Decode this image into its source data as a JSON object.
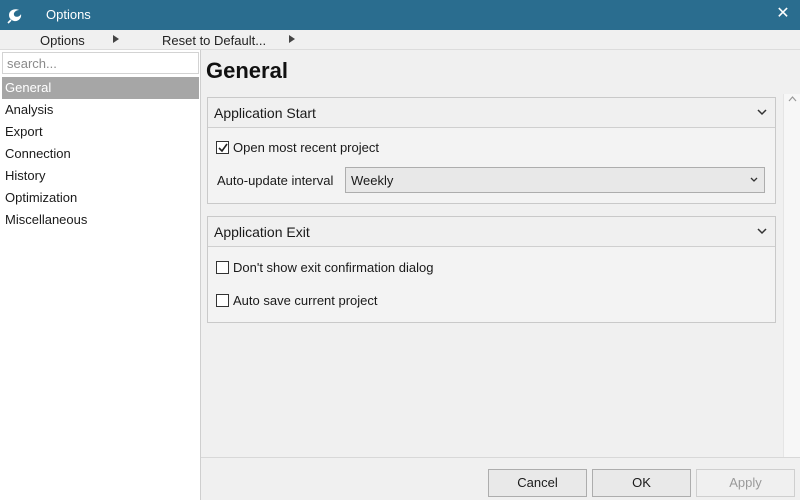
{
  "window": {
    "title": "Options",
    "close_glyph": "✕",
    "title_bar_color": "#2a6d8f",
    "logo_icon": "app-logo-icon"
  },
  "menu": {
    "options_label": "Options",
    "reset_label": "Reset to Default...",
    "arrow_icon": "triangle-right-icon"
  },
  "sidebar": {
    "search_placeholder": "search...",
    "selected_color": "#a6a6a6",
    "items": [
      {
        "label": "General",
        "selected": true
      },
      {
        "label": "Analysis"
      },
      {
        "label": "Export"
      },
      {
        "label": "Connection"
      },
      {
        "label": "History"
      },
      {
        "label": "Optimization"
      },
      {
        "label": "Miscellaneous"
      }
    ]
  },
  "main": {
    "title": "General",
    "sections": [
      {
        "title": "Application Start",
        "checkbox_open_recent": {
          "label": "Open most recent project",
          "checked": true
        },
        "auto_update": {
          "label": "Auto-update interval",
          "value": "Weekly"
        }
      },
      {
        "title": "Application Exit",
        "checkbox_no_confirm": {
          "label": "Don't show exit confirmation dialog",
          "checked": false
        },
        "checkbox_autosave": {
          "label": "Auto save current project",
          "checked": false
        }
      }
    ]
  },
  "footer": {
    "cancel_label": "Cancel",
    "ok_label": "OK",
    "apply_label": "Apply",
    "apply_enabled": false
  }
}
